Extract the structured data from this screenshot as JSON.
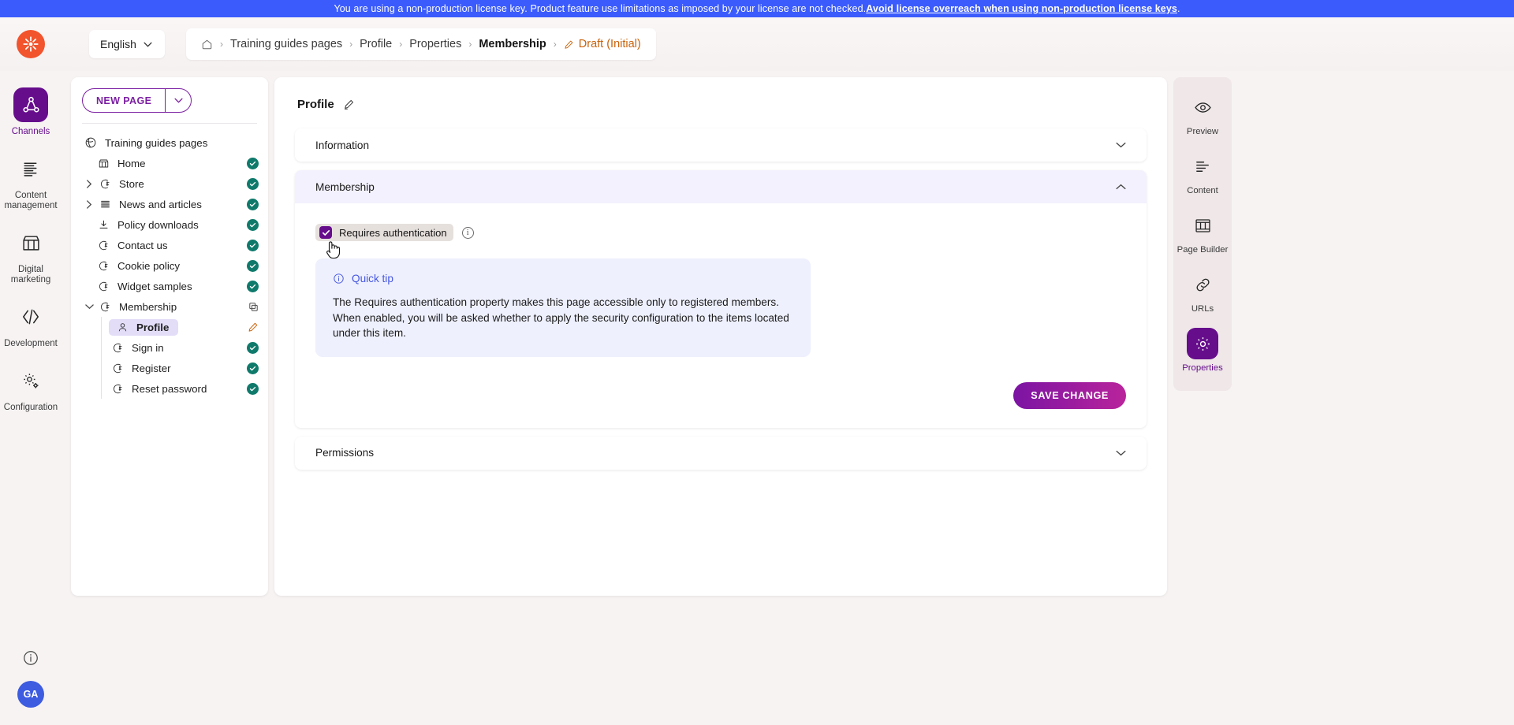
{
  "license_banner": {
    "text_before": "You are using a non-production license key. Product feature use limitations as imposed by your license are not checked. ",
    "link_text": "Avoid license overreach when using non-production license keys",
    "text_after": ".",
    "background": "#3b5bfd"
  },
  "header": {
    "logo_name": "kentico-logo",
    "language": {
      "label": "English",
      "chevron": "chevron-down-icon"
    },
    "breadcrumb": {
      "home_icon": "home-icon",
      "items": [
        {
          "label": "Training guides pages",
          "current": false
        },
        {
          "label": "Profile",
          "current": false
        },
        {
          "label": "Properties",
          "current": false
        },
        {
          "label": "Membership",
          "current": true
        }
      ],
      "status": {
        "label": "Draft (Initial)",
        "icon": "pencil-icon",
        "color": "#c9620a"
      }
    }
  },
  "left_rail": {
    "items": [
      {
        "label": "Channels",
        "icon": "channels-icon",
        "active": true
      },
      {
        "label": "Content management",
        "icon": "content-management-icon",
        "active": false
      },
      {
        "label": "Digital marketing",
        "icon": "digital-marketing-icon",
        "active": false
      },
      {
        "label": "Development",
        "icon": "code-icon",
        "active": false
      },
      {
        "label": "Configuration",
        "icon": "gear-icon",
        "active": false
      }
    ],
    "bottom": {
      "help_icon": "info-circle-icon",
      "avatar_initials": "GA"
    }
  },
  "pages_panel": {
    "new_page_button": {
      "label": "NEW PAGE",
      "dropdown_icon": "chevron-down-icon"
    },
    "tree": [
      {
        "label": "Training guides pages",
        "icon": "globe-icon",
        "level": 0,
        "caret": "",
        "status": "",
        "selected": false
      },
      {
        "label": "Home",
        "icon": "store-front-icon",
        "level": 1,
        "caret": "",
        "status": "published",
        "selected": false
      },
      {
        "label": "Store",
        "icon": "page-hash-icon",
        "level": 1,
        "caret": "collapsed",
        "status": "published",
        "selected": false
      },
      {
        "label": "News and articles",
        "icon": "list-lines-icon",
        "level": 1,
        "caret": "collapsed",
        "status": "published",
        "selected": false
      },
      {
        "label": "Policy downloads",
        "icon": "download-icon",
        "level": 1,
        "caret": "",
        "status": "published",
        "selected": false
      },
      {
        "label": "Contact us",
        "icon": "page-hash-icon",
        "level": 1,
        "caret": "",
        "status": "published",
        "selected": false
      },
      {
        "label": "Cookie policy",
        "icon": "page-hash-icon",
        "level": 1,
        "caret": "",
        "status": "published",
        "selected": false
      },
      {
        "label": "Widget samples",
        "icon": "page-hash-icon",
        "level": 1,
        "caret": "",
        "status": "published",
        "selected": false
      },
      {
        "label": "Membership",
        "icon": "page-hash-icon",
        "level": 1,
        "caret": "expanded",
        "status": "copy",
        "selected": false
      },
      {
        "label": "Profile",
        "icon": "user-icon",
        "level": 2,
        "caret": "",
        "status": "draft",
        "selected": true
      },
      {
        "label": "Sign in",
        "icon": "page-hash-icon",
        "level": 2,
        "caret": "",
        "status": "published",
        "selected": false
      },
      {
        "label": "Register",
        "icon": "page-hash-icon",
        "level": 2,
        "caret": "",
        "status": "published",
        "selected": false
      },
      {
        "label": "Reset password",
        "icon": "page-hash-icon",
        "level": 2,
        "caret": "",
        "status": "published",
        "selected": false
      }
    ]
  },
  "main": {
    "page_title": "Profile",
    "edit_icon": "pencil-icon",
    "sections": [
      {
        "title": "Information",
        "open": false,
        "chevron": "chevron-down-icon"
      },
      {
        "title": "Membership",
        "open": true,
        "chevron": "chevron-up-icon"
      },
      {
        "title": "Permissions",
        "open": false,
        "chevron": "chevron-down-icon"
      }
    ],
    "membership": {
      "checkbox": {
        "label": "Requires authentication",
        "checked": true,
        "info_icon": "info-circle-icon"
      },
      "tip": {
        "icon": "info-circle-icon",
        "title": "Quick tip",
        "line1": "The Requires authentication property makes this page accessible only to registered members.",
        "line2": "When enabled, you will be asked whether to apply the security configuration to the items located under this item."
      },
      "save_button": "SAVE CHANGE"
    }
  },
  "right_rail": {
    "items": [
      {
        "label": "Preview",
        "icon": "eye-icon",
        "active": false
      },
      {
        "label": "Content",
        "icon": "content-lines-icon",
        "active": false
      },
      {
        "label": "Page Builder",
        "icon": "page-builder-icon",
        "active": false
      },
      {
        "label": "URLs",
        "icon": "link-icon",
        "active": false
      },
      {
        "label": "Properties",
        "icon": "gear-icon",
        "active": true
      }
    ]
  },
  "colors": {
    "brand_purple": "#660d8c",
    "accent_orange": "#f2542d",
    "banner_blue": "#3b5bfd",
    "status_green": "#0f7a6b",
    "tip_blue": "#4657e0",
    "draft_orange": "#c9620a"
  }
}
